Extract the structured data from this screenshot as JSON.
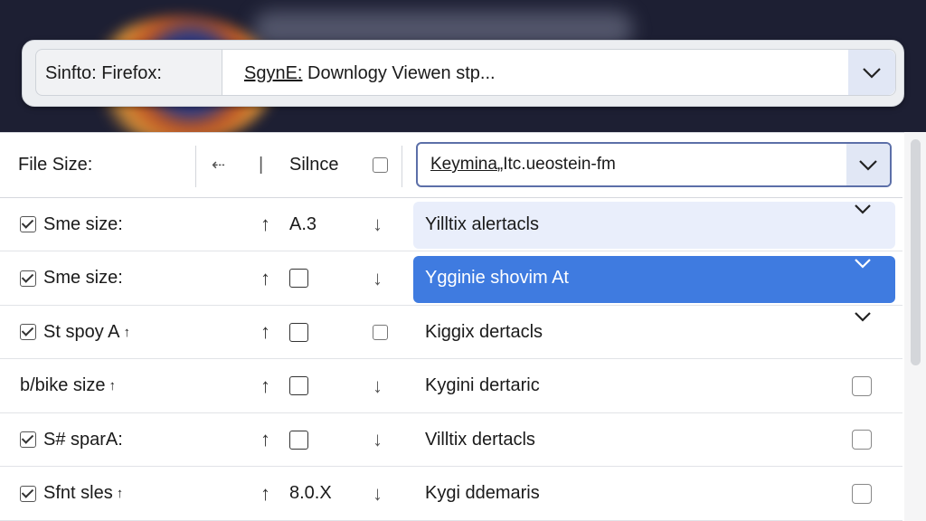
{
  "topbar": {
    "label": "Sinfto: Firefox:",
    "select_prefix": "SgynE:",
    "select_value": " Downlogy Viewen stp..."
  },
  "header": {
    "title": "File Size:",
    "back_glyph": "⇠",
    "bar_glyph": "|",
    "since_label": "Silnce",
    "select_underlined": "Keymina",
    "select_rest": "„Itc.ueostein-fm"
  },
  "rows": [
    {
      "name": "Sme size:",
      "checked": true,
      "suffix": "",
      "value": "A.3",
      "value_type": "text",
      "has_down": true,
      "down_is_box": false,
      "desc": "Yilltix alertacls",
      "end": "chevron",
      "highlight": "light"
    },
    {
      "name": "Sme size:",
      "checked": true,
      "suffix": "",
      "value": "",
      "value_type": "box",
      "has_down": true,
      "down_is_box": false,
      "desc": "Ygginie shovim At",
      "end": "chevron",
      "highlight": "selected"
    },
    {
      "name": "St spoy A",
      "checked": true,
      "suffix": "↑",
      "value": "",
      "value_type": "box",
      "has_down": false,
      "down_is_box": true,
      "desc": "Kiggix dertacls",
      "end": "chevron",
      "highlight": "none"
    },
    {
      "name": "b/bike size",
      "checked": false,
      "suffix": "↑",
      "value": "",
      "value_type": "box",
      "has_down": true,
      "down_is_box": false,
      "desc": "Kygini dertaric",
      "end": "checkbox",
      "highlight": "none"
    },
    {
      "name": "S# sparA:",
      "checked": true,
      "suffix": "",
      "value": "",
      "value_type": "box",
      "has_down": true,
      "down_is_box": false,
      "desc": "Villtix dertacls",
      "end": "checkbox",
      "highlight": "none"
    },
    {
      "name": "Sfnt sles",
      "checked": true,
      "suffix": "↑",
      "value": "8.0.X",
      "value_type": "text",
      "has_down": true,
      "down_is_box": false,
      "desc": "Kygi ddemaris",
      "end": "checkbox",
      "highlight": "none"
    }
  ],
  "colors": {
    "selected_row": "#3f7be0",
    "highlight_row": "#e9eefb",
    "header_backdrop": "#1d1f33"
  },
  "icons": {
    "chevron": "chevron-down-icon",
    "up": "arrow-up-icon",
    "down": "arrow-down-icon",
    "checkbox": "checkbox-icon"
  }
}
